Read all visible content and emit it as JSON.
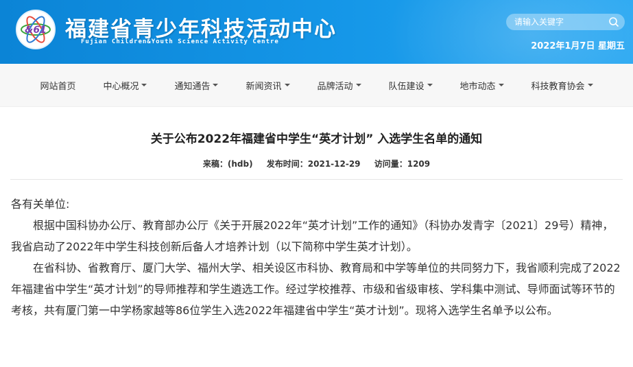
{
  "header": {
    "logo_text": "&61",
    "site_title": "福建省青少年科技活动中心",
    "site_subtitle": "Fujian Children&Youth Science Activity Centre",
    "search_placeholder": "请输入关键字",
    "date": "2022年1月7日 星期五",
    "colors": {
      "bar_start": "#0b84d6",
      "bar_end": "#2aa8f2"
    }
  },
  "nav": {
    "items": [
      {
        "label": "网站首页",
        "has_dropdown": false
      },
      {
        "label": "中心概况",
        "has_dropdown": true
      },
      {
        "label": "通知通告",
        "has_dropdown": true
      },
      {
        "label": "新闻资讯",
        "has_dropdown": true
      },
      {
        "label": "品牌活动",
        "has_dropdown": true
      },
      {
        "label": "队伍建设",
        "has_dropdown": true
      },
      {
        "label": "地市动态",
        "has_dropdown": true
      },
      {
        "label": "科技教育协会",
        "has_dropdown": true
      }
    ]
  },
  "article": {
    "title": "关于公布2022年福建省中学生“英才计划” 入选学生名单的通知",
    "source": "来稿：(hdb)",
    "published": "发布时间：2021-12-29",
    "views": "访问量：1209",
    "salutation": "各有关单位:",
    "paragraphs": [
      "根据中国科协办公厅、教育部办公厅《关于开展2022年“英才计划”工作的通知》（科协办发青字〔2021〕29号）精神，我省启动了2022年中学生科技创新后备人才培养计划（以下简称中学生英才计划）。",
      "在省科协、省教育厅、厦门大学、福州大学、相关设区市科协、教育局和中学等单位的共同努力下，我省顺利完成了2022年福建省中学生“英才计划”的导师推荐和学生遴选工作。经过学校推荐、市级和省级审核、学科集中测试、导师面试等环节的考核，共有厦门第一中学杨家越等86位学生入选2022年福建省中学生“英才计划”。现将入选学生名单予以公布。"
    ]
  }
}
